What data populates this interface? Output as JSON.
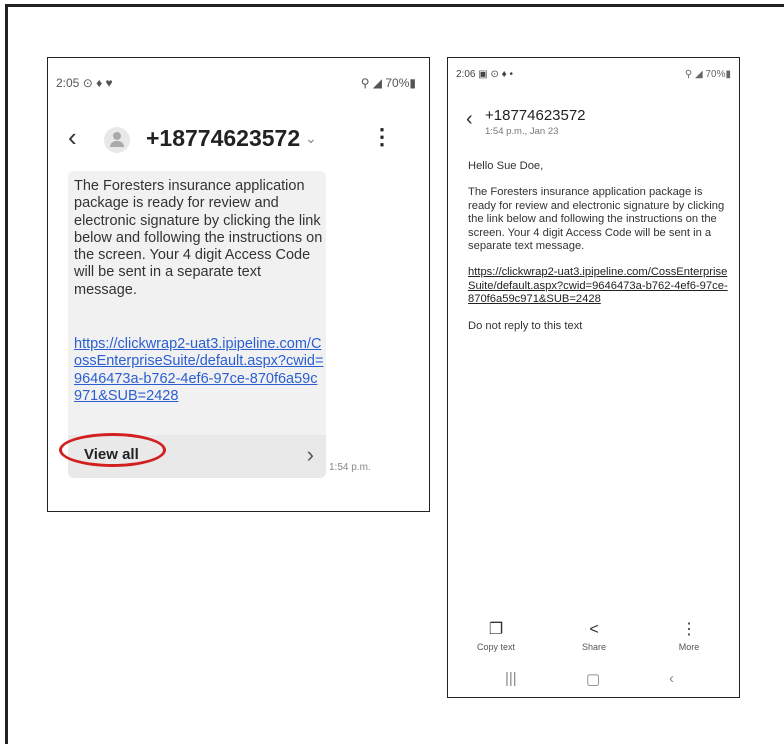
{
  "left": {
    "status_time": "2:05",
    "status_icons": "⊙ ♦ ♥",
    "status_right": "⚲ ◢ 70%▮",
    "back_icon": "back-arrow-icon",
    "phone_number": "+18774623572",
    "chevron": "⌄",
    "menu": "⋮",
    "message": "The Foresters insurance application package is ready for review and electronic signature by clicking the link below and following the instructions on the screen. Your 4 digit Access Code will be sent in a separate text message.",
    "link": "https://clickwrap2-uat3.ipipeline.com/CossEnterpriseSuite/default.aspx?cwid=9646473a-b762-4ef6-97ce-870f6a59c971&SUB=2428",
    "view_all": "View all",
    "view_all_arrow": "›",
    "time": "1:54 p.m.",
    "highlight_color": "#d21f1f"
  },
  "right": {
    "status_time": "2:06",
    "status_icons": "▣ ⊙ ♦  •",
    "status_right": "⚲ ◢ 70%▮",
    "phone_number": "+18774623572",
    "date": "1:54 p.m., Jan 23",
    "greeting": "Hello Sue Doe,",
    "message": "The Foresters insurance application package is ready for review and electronic signature by clicking the link below and following the instructions on the screen. Your 4 digit Access Code will be sent in a separate text message.",
    "link": "https://clickwrap2-uat3.ipipeline.com/CossEnterpriseSuite/default.aspx?cwid=9646473a-b762-4ef6-97ce-870f6a59c971&SUB=2428",
    "footer": "Do not reply to this text",
    "actions": [
      {
        "label": "Copy text",
        "icon": "copy-icon"
      },
      {
        "label": "Share",
        "icon": "share-icon"
      },
      {
        "label": "More",
        "icon": "more-icon"
      }
    ],
    "nav": [
      "recents",
      "home",
      "back"
    ]
  }
}
